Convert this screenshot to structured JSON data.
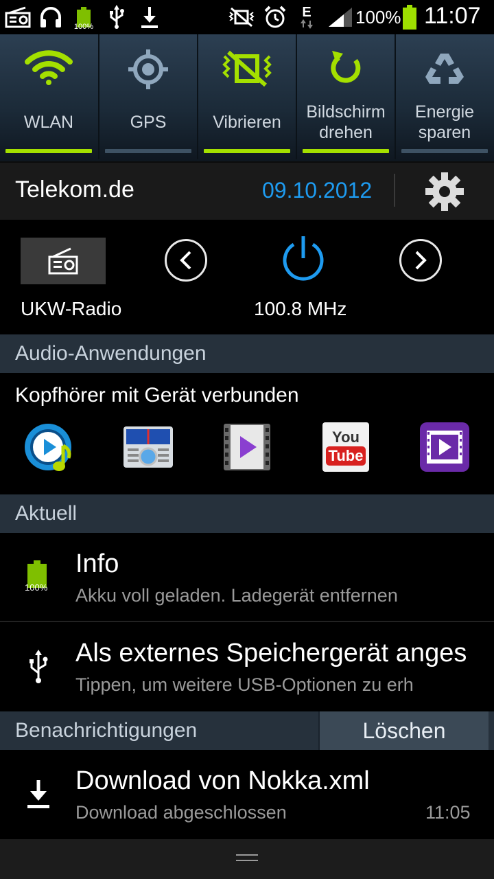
{
  "status_bar": {
    "left_icons": [
      "radio-icon",
      "headphones-icon",
      "battery-full-icon",
      "usb-icon",
      "download-icon"
    ],
    "left_battery_label": "100%",
    "network": "E",
    "battery_percent": "100%",
    "time": "11:07"
  },
  "quick_settings": [
    {
      "label": "WLAN",
      "icon": "wifi-icon",
      "active": true
    },
    {
      "label": "GPS",
      "icon": "gps-icon",
      "active": false
    },
    {
      "label": "Vibrieren",
      "icon": "vibrate-icon",
      "active": true
    },
    {
      "label_line1": "Bildschirm",
      "label_line2": "drehen",
      "icon": "rotate-icon",
      "active": true
    },
    {
      "label_line1": "Energie",
      "label_line2": "sparen",
      "icon": "power-saving-icon",
      "active": false
    }
  ],
  "carrier": {
    "name": "Telekom.de",
    "date": "09.10.2012"
  },
  "radio": {
    "label": "UKW-Radio",
    "frequency": "100.8 MHz"
  },
  "audio_section": {
    "header": "Audio-Anwendungen",
    "subtitle": "Kopfhörer mit Gerät verbunden",
    "apps": [
      "music-player-icon",
      "radio-app-icon",
      "video-player-icon",
      "youtube-icon",
      "video-hub-icon"
    ],
    "youtube_you": "You",
    "youtube_tube": "Tube"
  },
  "current_section": {
    "header": "Aktuell",
    "items": [
      {
        "icon": "battery-full-icon",
        "badge": "100%",
        "title": "Info",
        "subtitle": "Akku voll geladen. Ladegerät entfernen"
      },
      {
        "icon": "usb-icon",
        "title": "Als externes Speichergerät anges",
        "subtitle": "Tippen, um weitere USB-Optionen zu erh"
      }
    ]
  },
  "notifications_section": {
    "header": "Benachrichtigungen",
    "clear_label": "Löschen",
    "items": [
      {
        "icon": "download-icon",
        "title": "Download von Nokka.xml",
        "subtitle": "Download abgeschlossen",
        "time": "11:05"
      }
    ]
  },
  "colors": {
    "accent_green": "#a4e000",
    "accent_blue": "#1e9bf0",
    "header_bg": "#26313c"
  }
}
